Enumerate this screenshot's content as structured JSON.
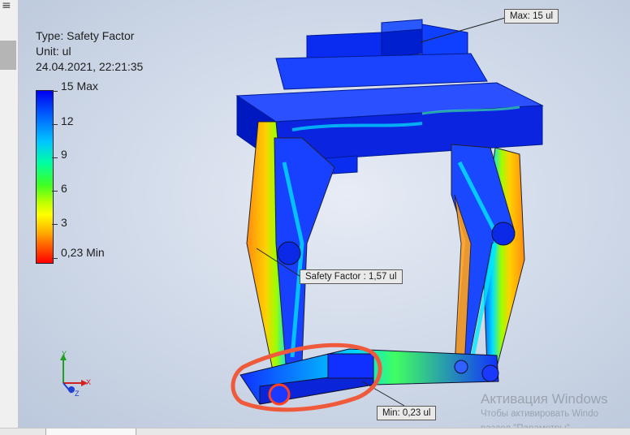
{
  "legend": {
    "type_line": "Type: Safety Factor",
    "unit_line": "Unit: ul",
    "timestamp": "24.04.2021, 22:21:35",
    "scale_labels": [
      "15 Max",
      "12",
      "9",
      "6",
      "3",
      "0,23 Min"
    ]
  },
  "callouts": {
    "max": "Max: 15 ul",
    "probe": "Safety Factor : 1,57 ul",
    "min": "Min: 0,23 ul"
  },
  "axis": {
    "x": "X",
    "y": "Y",
    "z": "Z"
  },
  "watermark": {
    "title": "Активация Windows",
    "line1": "Чтобы активировать Windo",
    "line2": "раздел \"Параметры\"."
  },
  "left_strip": {
    "menu_glyph": "≡"
  },
  "colors": {
    "max_blue": "#0000f0",
    "min_red": "#ff0000",
    "annotation_circle": "#f05a3c"
  }
}
